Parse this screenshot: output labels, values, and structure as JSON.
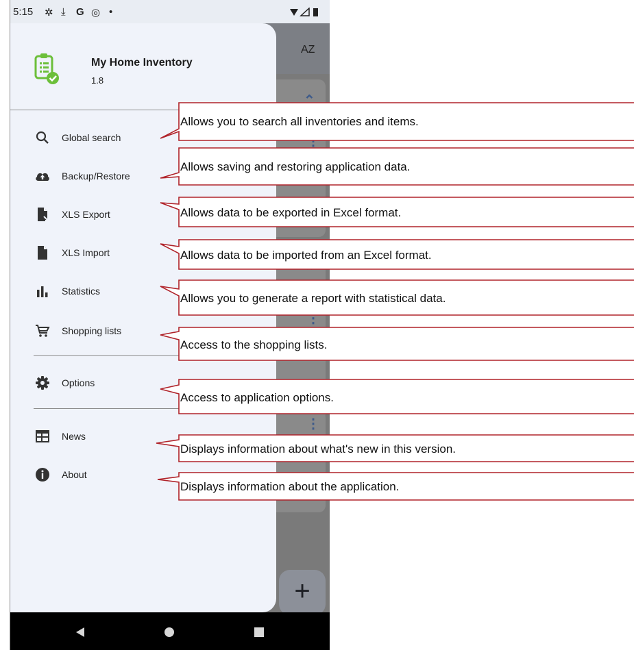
{
  "status_bar": {
    "time": "5:15"
  },
  "drawer": {
    "app_name": "My Home Inventory",
    "version": "1.8",
    "items": [
      {
        "label": "Global search",
        "icon": "search-icon"
      },
      {
        "label": "Backup/Restore",
        "icon": "cloud-upload-icon"
      },
      {
        "label": "XLS Export",
        "icon": "file-export-icon"
      },
      {
        "label": "XLS Import",
        "icon": "file-icon"
      },
      {
        "label": "Statistics",
        "icon": "bar-chart-icon"
      },
      {
        "label": "Shopping lists",
        "icon": "cart-icon"
      },
      {
        "label": "Options",
        "icon": "gear-icon"
      },
      {
        "label": "News",
        "icon": "news-icon"
      },
      {
        "label": "About",
        "icon": "info-icon"
      }
    ]
  },
  "toolbar": {
    "sort_label": "AZ"
  },
  "callouts": [
    "Allows you to search all inventories and items.",
    "Allows saving and restoring application data.",
    "Allows data to be exported in Excel format.",
    "Allows data to be imported from an Excel format.",
    "Allows you to generate a report with statistical data.",
    "Access to the shopping lists.",
    "Access to application options.",
    "Displays information about what's new in this version.",
    "Displays information about the application."
  ],
  "colors": {
    "callout_border": "#b0232a",
    "logo_green": "#6cbf3a",
    "drawer_bg": "#f0f3fa"
  }
}
